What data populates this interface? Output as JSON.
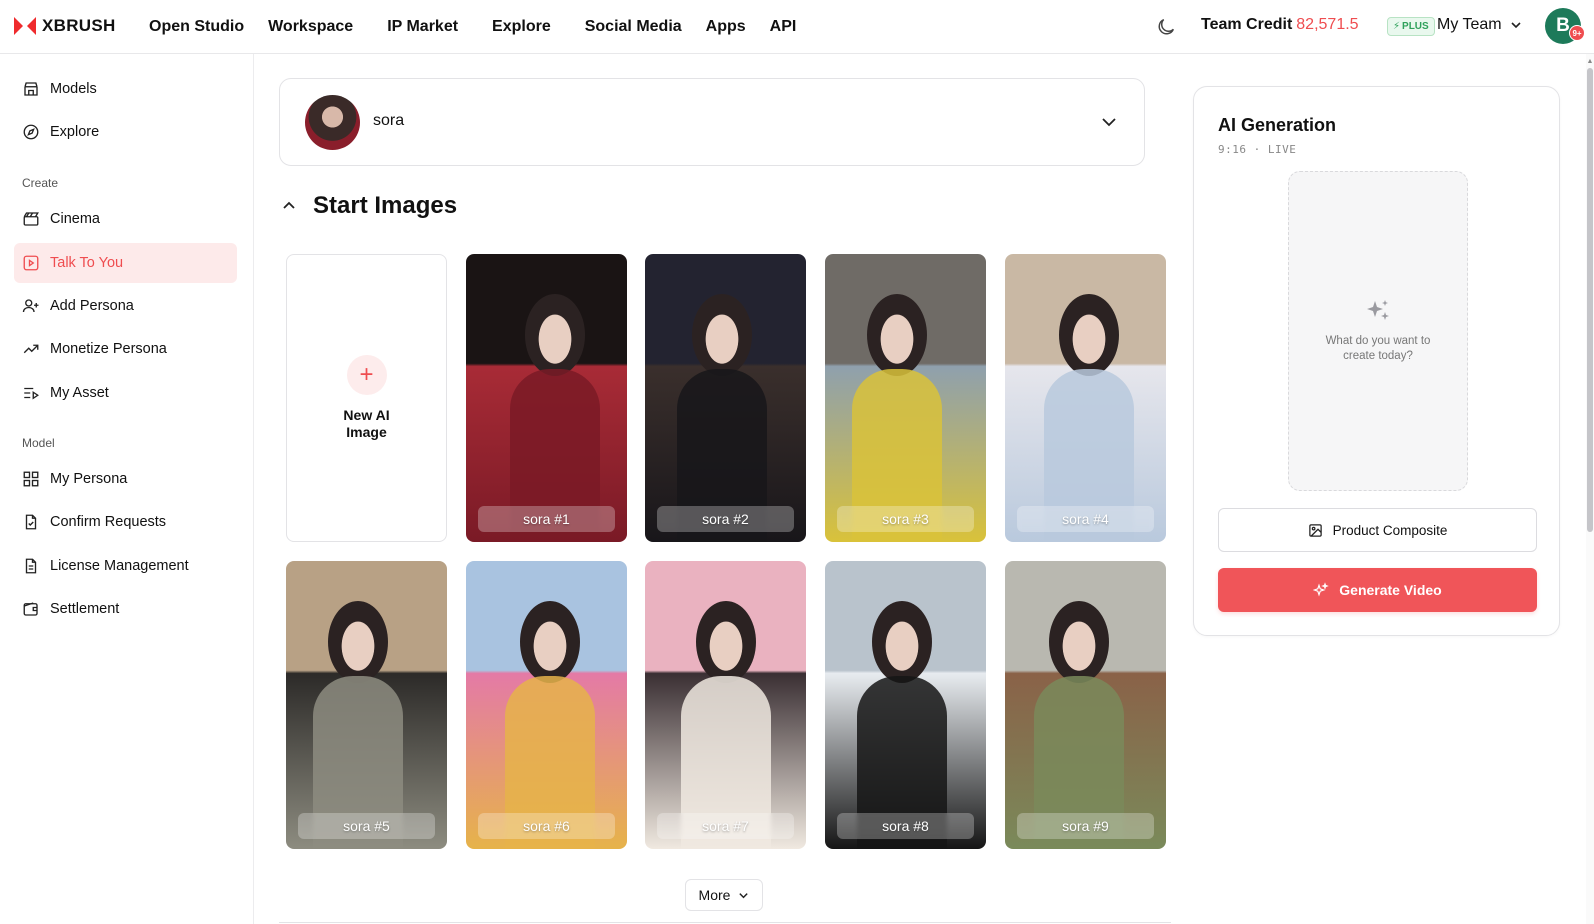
{
  "app": {
    "brand": "XBRUSH"
  },
  "nav": {
    "items": [
      "Open Studio",
      "Workspace",
      "IP Market",
      "Explore",
      "Social Media",
      "Apps",
      "API"
    ]
  },
  "header": {
    "credit_label": "Team Credit",
    "credit_amount": "82,571.5",
    "plan_badge": "PLUS",
    "team_name": "My Team",
    "avatar_initial": "B",
    "notification_badge": "9+"
  },
  "sidebar": {
    "top_items": [
      {
        "label": "Models",
        "icon": "store-icon"
      },
      {
        "label": "Explore",
        "icon": "compass-icon"
      }
    ],
    "create_heading": "Create",
    "create_items": [
      {
        "label": "Cinema",
        "icon": "clapper-icon"
      },
      {
        "label": "Talk To You",
        "icon": "play-square-icon",
        "active": true
      },
      {
        "label": "Add Persona",
        "icon": "user-plus-icon"
      },
      {
        "label": "Monetize Persona",
        "icon": "trending-up-icon"
      },
      {
        "label": "My Asset",
        "icon": "list-play-icon"
      }
    ],
    "model_heading": "Model",
    "model_items": [
      {
        "label": "My Persona",
        "icon": "grid-icon"
      },
      {
        "label": "Confirm Requests",
        "icon": "file-check-icon"
      },
      {
        "label": "License Management",
        "icon": "file-text-icon"
      },
      {
        "label": "Settlement",
        "icon": "wallet-icon"
      }
    ]
  },
  "persona": {
    "name": "sora"
  },
  "section": {
    "title": "Start Images"
  },
  "new_card": {
    "label": "New AI Image"
  },
  "images": [
    {
      "label": "sora #1",
      "colors": [
        "#1a1414",
        "#7a1a26",
        "#a82b36"
      ]
    },
    {
      "label": "sora #2",
      "colors": [
        "#232330",
        "#18161a",
        "#3a2f2c"
      ]
    },
    {
      "label": "sora #3",
      "colors": [
        "#6f6b66",
        "#d9c23a",
        "#8fa0ad"
      ]
    },
    {
      "label": "sora #4",
      "colors": [
        "#c9b8a4",
        "#b9c9dd",
        "#e6e6ec"
      ]
    },
    {
      "label": "sora #5",
      "colors": [
        "#b8a185",
        "#8d8c80",
        "#2c2a28"
      ]
    },
    {
      "label": "sora #6",
      "colors": [
        "#a9c3e0",
        "#e6b34a",
        "#e47aa6"
      ]
    },
    {
      "label": "sora #7",
      "colors": [
        "#eab2c0",
        "#f0e9e0",
        "#3a2f33"
      ]
    },
    {
      "label": "sora #8",
      "colors": [
        "#b9c3cc",
        "#151515",
        "#e8ecf0"
      ]
    },
    {
      "label": "sora #9",
      "colors": [
        "#b9b8b0",
        "#7a8a5a",
        "#8a6248"
      ]
    }
  ],
  "more_button": {
    "label": "More"
  },
  "generation": {
    "title": "AI Generation",
    "subtitle": "9:16 · LIVE",
    "placeholder_text": "What do you want to create today?",
    "product_composite_label": "Product Composite",
    "generate_label": "Generate Video",
    "accent": "#f05559"
  }
}
